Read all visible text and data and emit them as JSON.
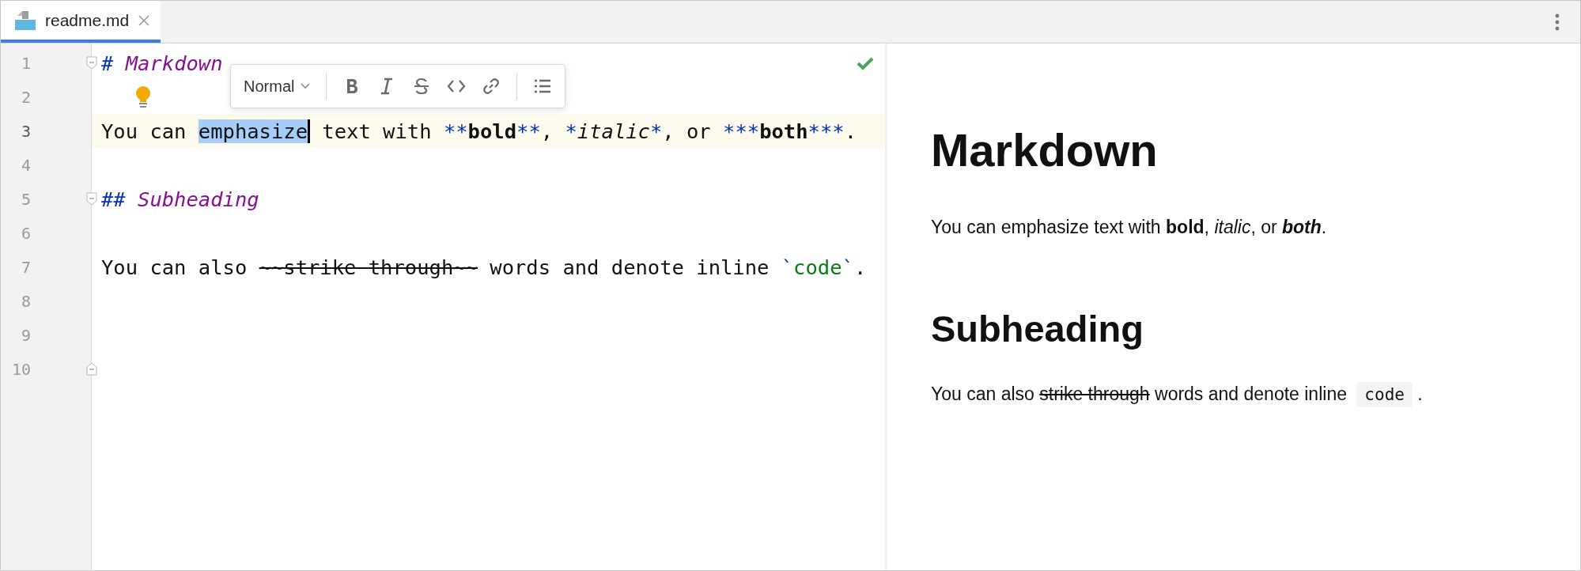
{
  "tabs": [
    {
      "label": "readme.md",
      "selected": true
    }
  ],
  "editor": {
    "lines": [
      {
        "number": "1",
        "current": false,
        "fold_marker": {
          "kind": "start"
        },
        "tokens": [
          {
            "text": "# ",
            "kind": "heading_marker"
          },
          {
            "text": "Markdown",
            "kind": "heading"
          }
        ]
      },
      {
        "number": "2",
        "current": false,
        "bulb": true
      },
      {
        "number": "3",
        "current": true,
        "tokens": [
          {
            "text": "You can ",
            "kind": "plain"
          },
          {
            "text": "emphasize",
            "kind": "selection"
          },
          {
            "text": " text with ",
            "kind": "plain"
          },
          {
            "text": "**",
            "kind": "marker"
          },
          {
            "text": "bold",
            "kind": "bold"
          },
          {
            "text": "**",
            "kind": "marker"
          },
          {
            "text": ", ",
            "kind": "plain"
          },
          {
            "text": "*",
            "kind": "marker_italic"
          },
          {
            "text": "italic",
            "kind": "italic"
          },
          {
            "text": "*",
            "kind": "marker_italic"
          },
          {
            "text": ", or ",
            "kind": "plain"
          },
          {
            "text": "***",
            "kind": "marker"
          },
          {
            "text": "both",
            "kind": "bold"
          },
          {
            "text": "***",
            "kind": "marker"
          },
          {
            "text": ".",
            "kind": "plain"
          }
        ]
      },
      {
        "number": "4",
        "current": false
      },
      {
        "number": "5",
        "current": false,
        "fold_marker": {
          "kind": "start"
        },
        "tokens": [
          {
            "text": "## ",
            "kind": "heading_marker"
          },
          {
            "text": "Subheading",
            "kind": "heading"
          }
        ]
      },
      {
        "number": "6",
        "current": false
      },
      {
        "number": "7",
        "current": false,
        "tokens": [
          {
            "text": "You can also ",
            "kind": "plain"
          },
          {
            "text": "~~strike through~~",
            "kind": "strike"
          },
          {
            "text": " words and denote inline ",
            "kind": "plain"
          },
          {
            "text": "`",
            "kind": "marker"
          },
          {
            "text": "code",
            "kind": "code"
          },
          {
            "text": "`",
            "kind": "marker"
          },
          {
            "text": ".",
            "kind": "plain"
          }
        ]
      },
      {
        "number": "8",
        "current": false
      },
      {
        "number": "9",
        "current": false
      },
      {
        "number": "10",
        "current": false,
        "fold_marker": {
          "kind": "end"
        }
      }
    ]
  },
  "format_toolbar": {
    "style_dropdown": {
      "value": "Normal"
    },
    "buttons": [
      {
        "kind": "bold"
      },
      {
        "kind": "italic"
      },
      {
        "kind": "strike"
      },
      {
        "kind": "code"
      },
      {
        "kind": "link"
      },
      {
        "kind": "separator"
      },
      {
        "kind": "list"
      }
    ]
  },
  "preview": {
    "blocks": [
      {
        "kind": "h1",
        "spans": [
          {
            "text": "Markdown",
            "kind": "plain"
          }
        ]
      },
      {
        "kind": "p",
        "spans": [
          {
            "text": "You can emphasize text with ",
            "kind": "plain"
          },
          {
            "text": "bold",
            "kind": "bold"
          },
          {
            "text": ", ",
            "kind": "plain"
          },
          {
            "text": "italic",
            "kind": "italic"
          },
          {
            "text": ", or ",
            "kind": "plain"
          },
          {
            "text": "both",
            "kind": "bolditalic"
          },
          {
            "text": ".",
            "kind": "plain"
          }
        ]
      },
      {
        "kind": "h2",
        "spans": [
          {
            "text": "Subheading",
            "kind": "plain"
          }
        ]
      },
      {
        "kind": "p",
        "spans": [
          {
            "text": "You can also ",
            "kind": "plain"
          },
          {
            "text": "strike through",
            "kind": "strike"
          },
          {
            "text": " words and denote inline ",
            "kind": "plain"
          },
          {
            "text": "code",
            "kind": "code"
          },
          {
            "text": " .",
            "kind": "plain"
          }
        ]
      }
    ]
  }
}
